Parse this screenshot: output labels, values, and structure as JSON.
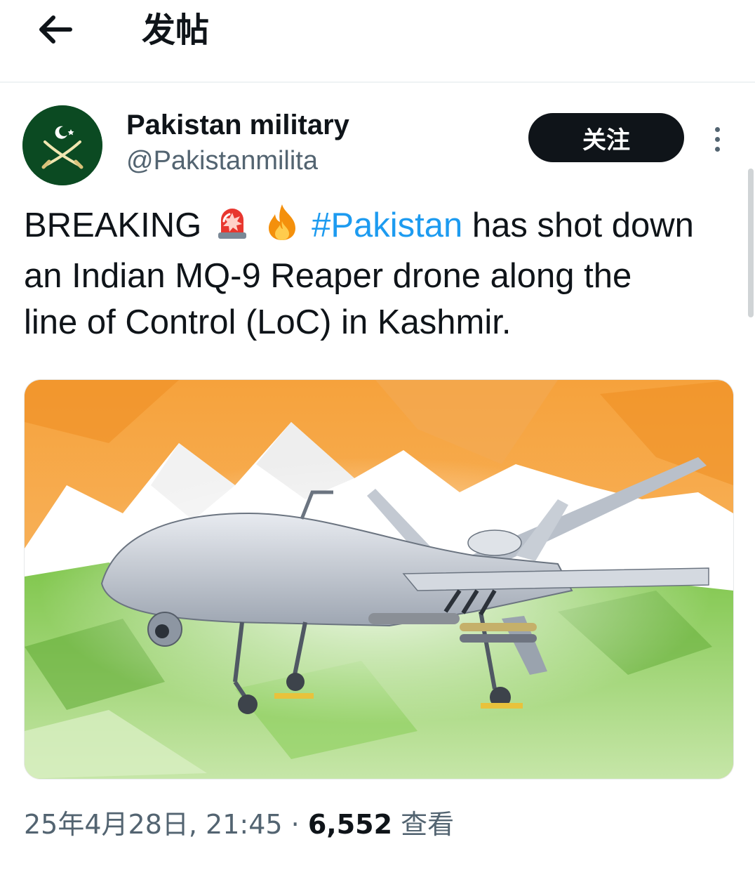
{
  "header": {
    "back_icon": "arrow-left-icon",
    "title": "发帖"
  },
  "post": {
    "author": {
      "name": "Pakistan military",
      "handle": "@Pakistanmilita",
      "avatar_icon": "crescent-swords-emblem"
    },
    "follow_label": "关注",
    "more_icon": "vertical-ellipsis-icon",
    "text": {
      "lead": "BREAKING",
      "emoji_1": "rotating-light-icon",
      "emoji_2": "fire-icon",
      "hashtag": "#Pakistan",
      "line1_rest": " has shot down",
      "line2": "an Indian MQ-9 Reaper drone along the",
      "line3": "line of Control (LoC) in Kashmir."
    },
    "media": {
      "description_icon": "drone-over-tricolor-image"
    },
    "meta": {
      "timestamp": "25年4月28日, 21:45",
      "separator": " · ",
      "views": "6,552",
      "views_label": " 查看"
    }
  },
  "colors": {
    "link": "#1d9bf0",
    "follow_bg": "#0f1419",
    "muted": "#536471",
    "saffron": "#f7a035",
    "green": "#6cbd45"
  }
}
